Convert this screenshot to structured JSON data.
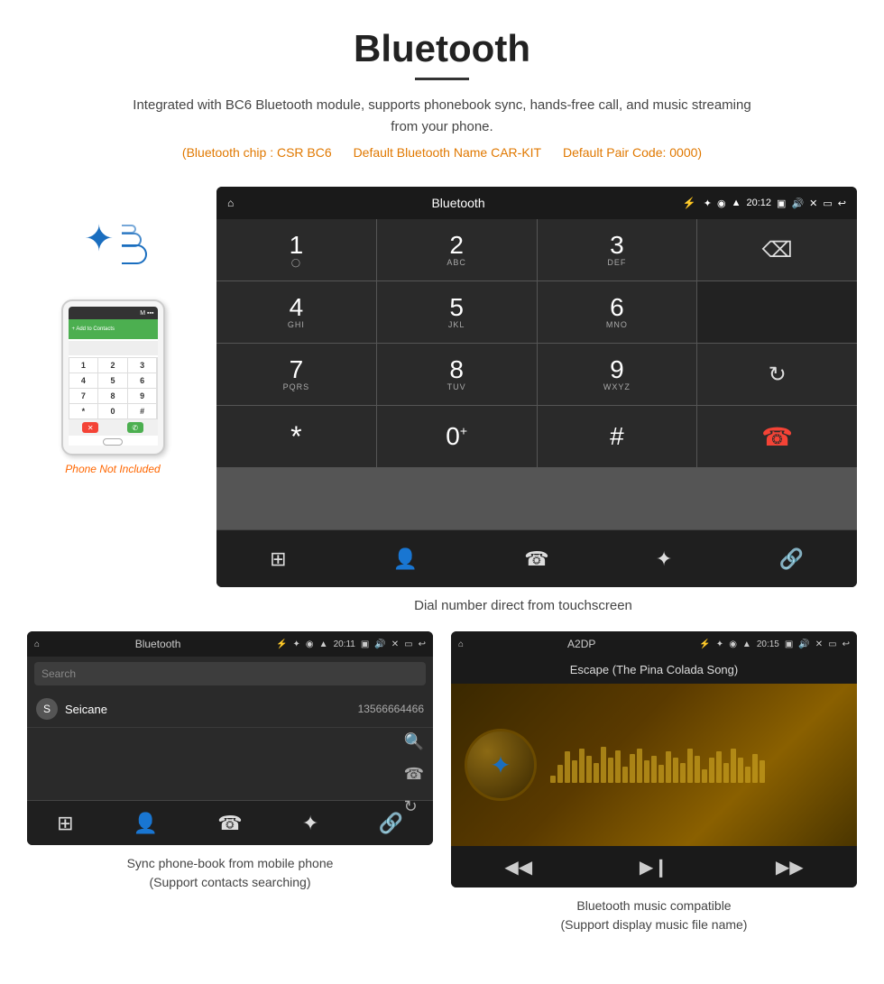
{
  "header": {
    "title": "Bluetooth",
    "subtitle": "Integrated with BC6 Bluetooth module, supports phonebook sync, hands-free call, and music streaming from your phone.",
    "specs_chip": "(Bluetooth chip : CSR BC6",
    "specs_name": "Default Bluetooth Name CAR-KIT",
    "specs_pair": "Default Pair Code: 0000)"
  },
  "phone_section": {
    "not_included": "Phone Not Included"
  },
  "dialpad": {
    "screen_title": "Bluetooth",
    "time": "20:12",
    "keys": [
      {
        "num": "1",
        "sub": ""
      },
      {
        "num": "2",
        "sub": "ABC"
      },
      {
        "num": "3",
        "sub": "DEF"
      },
      {
        "num": "4",
        "sub": "GHI"
      },
      {
        "num": "5",
        "sub": "JKL"
      },
      {
        "num": "6",
        "sub": "MNO"
      },
      {
        "num": "7",
        "sub": "PQRS"
      },
      {
        "num": "8",
        "sub": "TUV"
      },
      {
        "num": "9",
        "sub": "WXYZ"
      },
      {
        "num": "*",
        "sub": ""
      },
      {
        "num": "0",
        "sub": "+"
      },
      {
        "num": "#",
        "sub": ""
      }
    ],
    "caption": "Dial number direct from touchscreen"
  },
  "phonebook": {
    "screen_title": "Bluetooth",
    "time": "20:11",
    "search_placeholder": "Search",
    "contact_initial": "S",
    "contact_name": "Seicane",
    "contact_number": "13566664466",
    "caption_line1": "Sync phone-book from mobile phone",
    "caption_line2": "(Support contacts searching)"
  },
  "music": {
    "screen_title": "A2DP",
    "time": "20:15",
    "song_name": "Escape (The Pina Colada Song)",
    "eq_bars": [
      8,
      20,
      35,
      25,
      38,
      30,
      22,
      40,
      28,
      36,
      18,
      32,
      38,
      25,
      30,
      20,
      35,
      28,
      22,
      38,
      30,
      15,
      28,
      35,
      22,
      38,
      28,
      18,
      32,
      25
    ],
    "caption_line1": "Bluetooth music compatible",
    "caption_line2": "(Support display music file name)"
  },
  "icons": {
    "home": "⌂",
    "usb": "⚡",
    "bluetooth": "✦",
    "location": "◉",
    "wifi": "▲",
    "time_icon": "",
    "camera": "📷",
    "volume": "🔊",
    "close_x": "✕",
    "rect": "▭",
    "back": "↩",
    "backspace": "⌫",
    "refresh": "↻",
    "call_green": "📞",
    "call_red": "📵",
    "grid": "⊞",
    "person": "👤",
    "phone": "☎",
    "bt": "⚡",
    "link": "🔗",
    "search": "🔍",
    "prev": "⏮",
    "playpause": "⏯",
    "next": "⏭"
  }
}
